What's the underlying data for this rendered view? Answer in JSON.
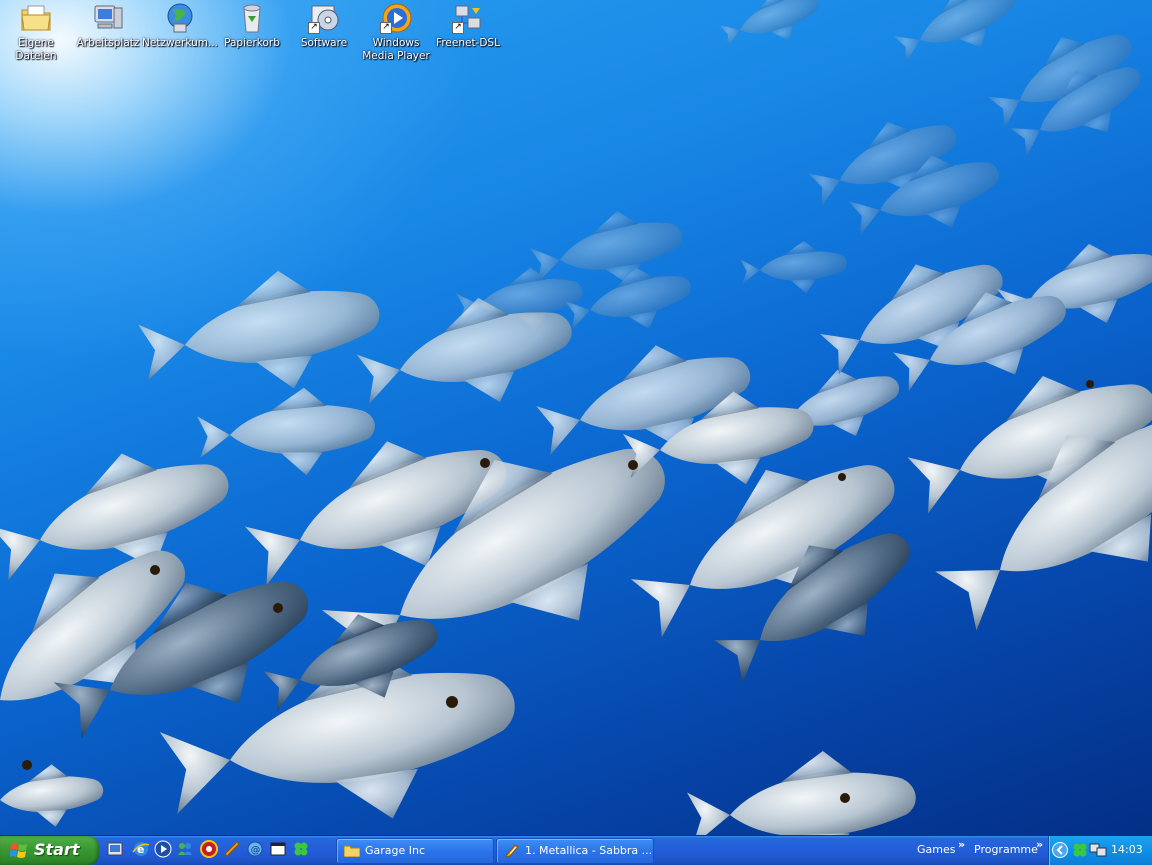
{
  "desktop_icons": [
    {
      "label": "Eigene Dateien",
      "icon": "my-documents-icon",
      "shortcut": false
    },
    {
      "label": "Arbeitsplatz",
      "icon": "my-computer-icon",
      "shortcut": false
    },
    {
      "label": "Netzwerkum...",
      "icon": "network-places-icon",
      "shortcut": false
    },
    {
      "label": "Papierkorb",
      "icon": "recycle-bin-icon",
      "shortcut": false
    },
    {
      "label": "Software",
      "icon": "software-cd-icon",
      "shortcut": true
    },
    {
      "label": "Windows Media Player",
      "icon": "media-player-icon",
      "shortcut": true
    },
    {
      "label": "Freenet-DSL",
      "icon": "dsl-connection-icon",
      "shortcut": true
    }
  ],
  "taskbar": {
    "start_label": "Start",
    "quick_launch": [
      "show-desktop-icon",
      "internet-explorer-icon",
      "media-player-icon",
      "messenger-icon",
      "app-icon-red",
      "app-icon-orange",
      "app-icon-globe",
      "app-icon-window",
      "clover-icon"
    ],
    "tasks": [
      {
        "label": "Garage Inc",
        "icon": "folder-icon"
      },
      {
        "label": "1. Metallica - Sabbra ...",
        "icon": "winamp-icon"
      }
    ],
    "toolbars": [
      {
        "label": "Games"
      },
      {
        "label": "Programme"
      }
    ],
    "chevron": "»",
    "tray_icons": [
      "expand-tray-icon",
      "clover-tray-icon",
      "network-tray-icon"
    ],
    "clock": "14:03"
  },
  "colors": {
    "taskbar_blue": "#245edb",
    "start_green": "#3c9b34",
    "tray_blue": "#0f8fe6"
  }
}
